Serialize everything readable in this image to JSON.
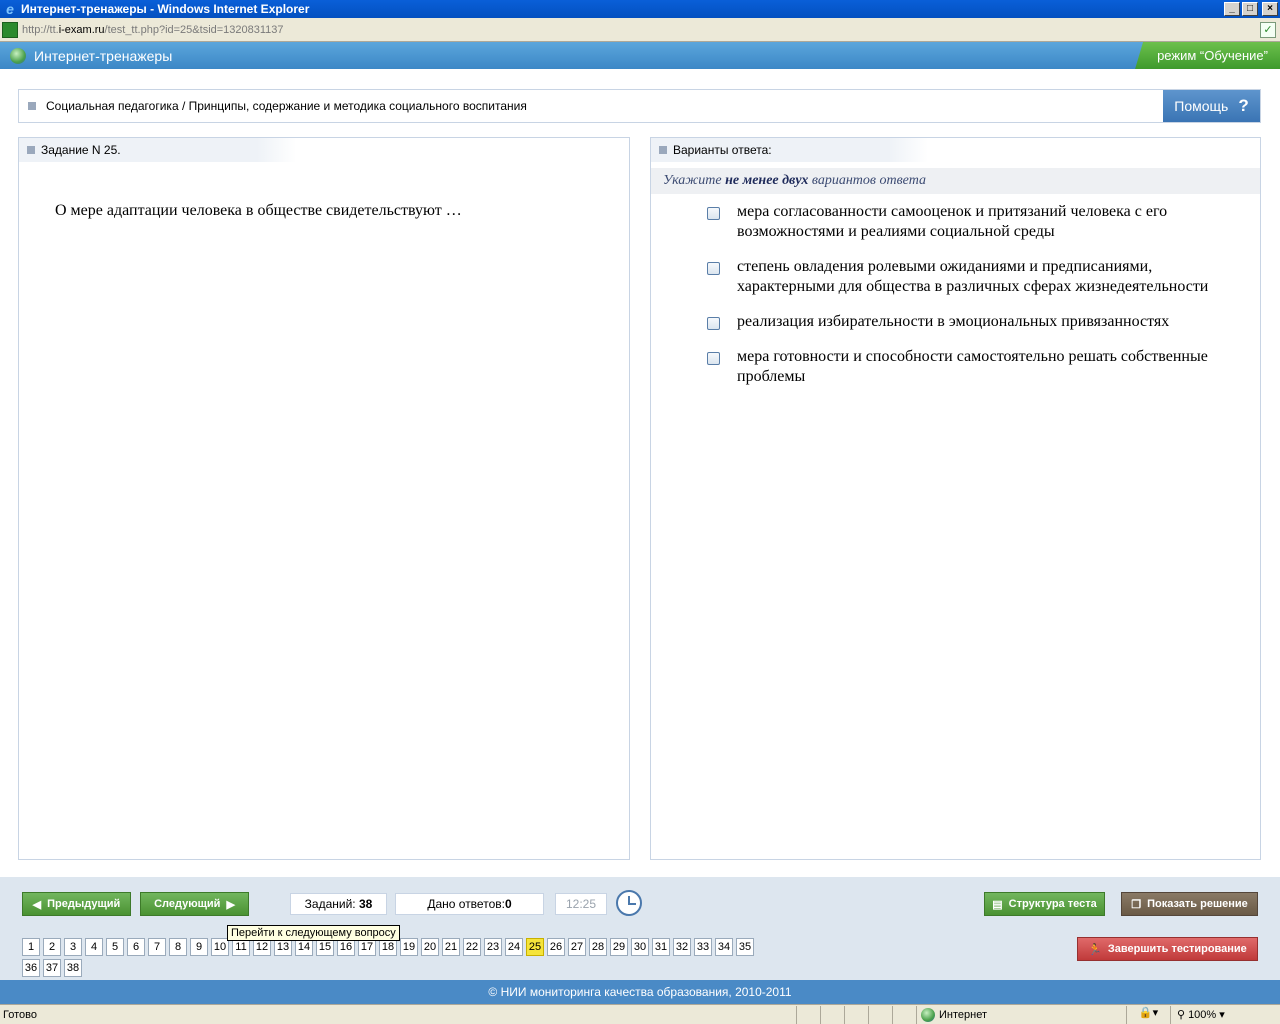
{
  "window": {
    "title": "Интернет-тренажеры - Windows Internet Explorer",
    "min_glyph": "_",
    "max_glyph": "□",
    "close_glyph": "×"
  },
  "address": {
    "url_prefix": "http://tt.",
    "url_domain": "i-exam.ru",
    "url_suffix": "/test_tt.php?id=25&tsid=1320831137"
  },
  "header": {
    "app_title": "Интернет-тренажеры",
    "mode": "режим “Обучение”"
  },
  "breadcrumb": {
    "text": "Социальная педагогика / Принципы, содержание и методика социального воспитания",
    "help_label": "Помощь",
    "help_glyph": "?"
  },
  "task": {
    "heading": "Задание N 25.",
    "question": "О мере адаптации человека в обществе свидетельствуют …"
  },
  "answers": {
    "heading": "Варианты ответа:",
    "instruction_pre": "Укажите ",
    "instruction_bold": "не менее двух",
    "instruction_post": " вариантов ответа",
    "options": [
      {
        "text": "мера согласованности самооценок и притязаний человека с его возможностями и реалиями социальной среды",
        "checked": false
      },
      {
        "text": "степень овладения ролевыми ожиданиями и предписаниями, характерными для общества в различных сферах жизнедеятельности",
        "checked": false
      },
      {
        "text": "реализация избирательности в эмоциональных привязанностях",
        "checked": false
      },
      {
        "text": "мера готовности и способности самостоятельно решать собственные проблемы",
        "checked": false
      }
    ]
  },
  "controls": {
    "prev_label": "Предыдущий",
    "next_label": "Следующий",
    "tasks_label": "Заданий:",
    "tasks_count": "38",
    "answered_label": "Дано ответов:",
    "answered_count": "0",
    "timer": "12:25",
    "tooltip": "Перейти к следующему вопросу",
    "structure_label": "Структура теста",
    "solution_label": "Показать решение",
    "finish_label": "Завершить тестирование",
    "current_question": "25",
    "question_numbers": [
      "1",
      "2",
      "3",
      "4",
      "5",
      "6",
      "7",
      "8",
      "9",
      "10",
      "11",
      "12",
      "13",
      "14",
      "15",
      "16",
      "17",
      "18",
      "19",
      "20",
      "21",
      "22",
      "23",
      "24",
      "25",
      "26",
      "27",
      "28",
      "29",
      "30",
      "31",
      "32",
      "33",
      "34",
      "35",
      "36",
      "37",
      "38"
    ]
  },
  "footer": {
    "copyright": "© НИИ мониторинга качества образования, 2010-2011"
  },
  "statusbar": {
    "status": "Готово",
    "zone": "Интернет",
    "zoom": "100%"
  }
}
